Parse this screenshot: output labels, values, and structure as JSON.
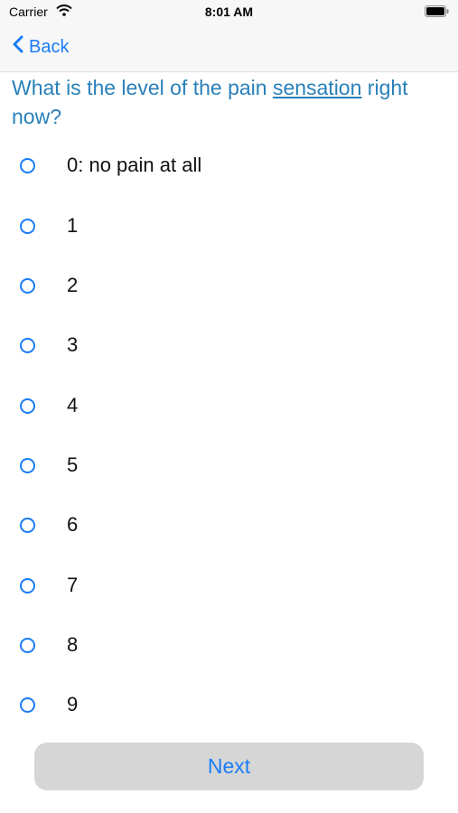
{
  "status_bar": {
    "carrier": "Carrier",
    "time": "8:01 AM"
  },
  "nav": {
    "back_label": "Back"
  },
  "question": {
    "text_before": "What is the level of the pain ",
    "underlined": "sensation",
    "text_after": " right now?"
  },
  "options": [
    {
      "label": "0: no pain at all"
    },
    {
      "label": "1"
    },
    {
      "label": "2"
    },
    {
      "label": "3"
    },
    {
      "label": "4"
    },
    {
      "label": "5"
    },
    {
      "label": "6"
    },
    {
      "label": "7"
    },
    {
      "label": "8"
    },
    {
      "label": "9"
    }
  ],
  "footer": {
    "next_label": "Next"
  },
  "colors": {
    "accent": "#1a7cf5",
    "question": "#2980b9",
    "button_bg": "#d6d6d6"
  }
}
